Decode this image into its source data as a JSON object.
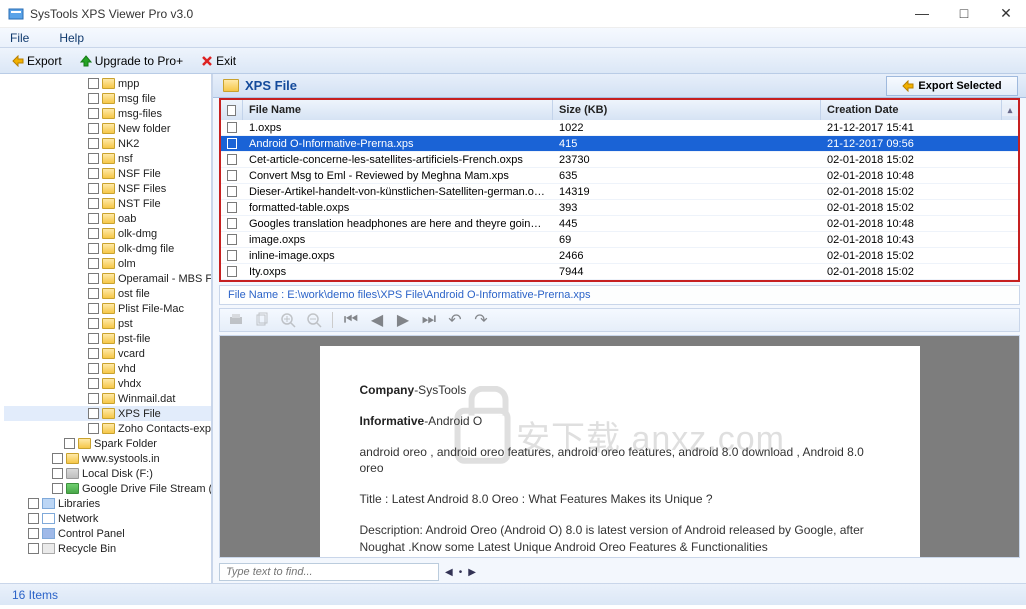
{
  "window": {
    "title": "SysTools XPS Viewer Pro v3.0"
  },
  "menu": {
    "file": "File",
    "help": "Help"
  },
  "toolbar": {
    "export": "Export",
    "upgrade": "Upgrade to Pro+",
    "exit": "Exit"
  },
  "tree": {
    "folders": [
      "mpp",
      "msg file",
      "msg-files",
      "New folder",
      "NK2",
      "nsf",
      "NSF File",
      "NSF Files",
      "NST File",
      "oab",
      "olk-dmg",
      "olk-dmg file",
      "olm",
      "Operamail - MBS File",
      "ost file",
      "Plist File-Mac",
      "pst",
      "pst-file",
      "vcard",
      "vhd",
      "vhdx",
      "Winmail.dat",
      "XPS File",
      "Zoho Contacts-exported"
    ],
    "selected": "XPS File",
    "spark": "Spark Folder",
    "sys": "www.systools.in",
    "localF": "Local Disk (F:)",
    "gdrive": "Google Drive File Stream (G:)",
    "libraries": "Libraries",
    "network": "Network",
    "cpanel": "Control Panel",
    "recycle": "Recycle Bin"
  },
  "panel": {
    "title": "XPS File",
    "exportSel": "Export Selected"
  },
  "table": {
    "cols": {
      "fname": "File Name",
      "size": "Size (KB)",
      "date": "Creation Date"
    },
    "rows": [
      {
        "fname": "1.oxps",
        "size": "1022",
        "date": "21-12-2017 15:41"
      },
      {
        "fname": "Android O-Informative-Prerna.xps",
        "size": "415",
        "date": "21-12-2017 09:56",
        "sel": true
      },
      {
        "fname": "Cet-article-concerne-les-satellites-artificiels-French.oxps",
        "size": "23730",
        "date": "02-01-2018 15:02"
      },
      {
        "fname": "Convert Msg to Eml - Reviewed by Meghna Mam.xps",
        "size": "635",
        "date": "02-01-2018 10:48"
      },
      {
        "fname": "Dieser-Artikel-handelt-von-künstlichen-Satelliten-german.oxps",
        "size": "14319",
        "date": "02-01-2018 15:02"
      },
      {
        "fname": "formatted-table.oxps",
        "size": "393",
        "date": "02-01-2018 15:02"
      },
      {
        "fname": "Googles translation headphones are here and theyre going to start a war published...",
        "size": "445",
        "date": "02-01-2018 10:48"
      },
      {
        "fname": "image.oxps",
        "size": "69",
        "date": "02-01-2018 10:43"
      },
      {
        "fname": "inline-image.oxps",
        "size": "2466",
        "date": "02-01-2018 15:02"
      },
      {
        "fname": "Ity.oxps",
        "size": "7944",
        "date": "02-01-2018 15:02"
      }
    ]
  },
  "filepath": "File Name : E:\\work\\demo files\\XPS File\\Android O-Informative-Prerna.xps",
  "doc": {
    "l1a": "Company",
    "l1b": "-SysTools",
    "l2a": "Informative",
    "l2b": "-Android O",
    "p1": "android oreo , android oreo features, android oreo features, android 8.0 download , Android 8.0 oreo",
    "p2": "Title : Latest Android 8.0 Oreo : What Features Makes its Unique ?",
    "p3": "Description: Android Oreo (Android O) 8.0 is latest version of Android released by Google, after Noughat .Know some Latest Unique Android Oreo Features & Functionalities"
  },
  "find": {
    "placeholder": "Type text to find..."
  },
  "status": {
    "items": "16 Items"
  },
  "watermark": "安下载 anxz.com"
}
